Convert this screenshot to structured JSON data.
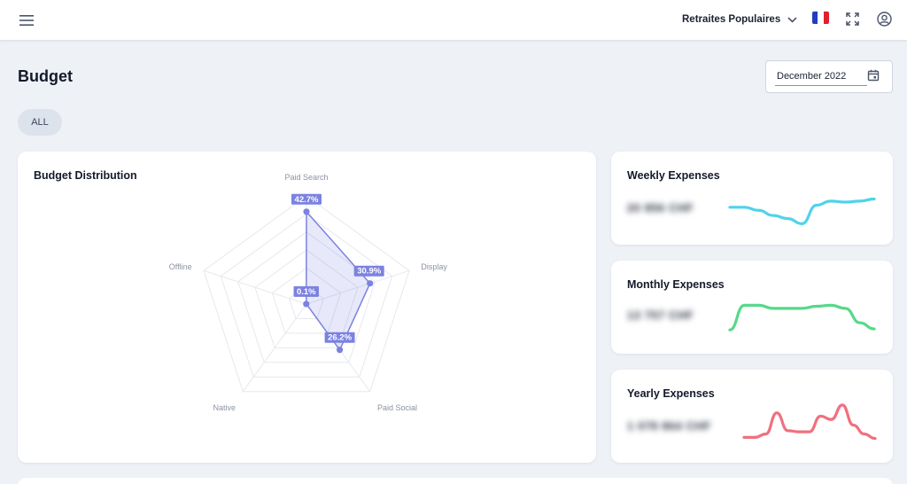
{
  "topbar": {
    "menu_icon": "hamburger-menu-icon",
    "organization": "Retraites Populaires",
    "language_flag": "france-flag-icon",
    "flag_colors": [
      "#1f3fbf",
      "#ffffff",
      "#e0202e"
    ],
    "fullscreen_icon": "fullscreen-icon",
    "account_icon": "user-account-icon"
  },
  "page": {
    "title": "Budget",
    "date_filter": "December 2022",
    "calendar_icon": "calendar-icon",
    "filter_chip": "ALL"
  },
  "radar_card": {
    "title": "Budget Distribution",
    "accent": "#7b82e0"
  },
  "chart_data": {
    "type": "radar",
    "categories": [
      "Paid Search",
      "Display",
      "Paid Social",
      "Native",
      "Offline"
    ],
    "values": [
      42.7,
      30.9,
      26.2,
      0.0,
      0.1
    ],
    "labels": [
      "42.7%",
      "30.9%",
      "26.2%",
      "",
      "0.1%"
    ],
    "rmax": 50,
    "grid_rings": 6
  },
  "stats": [
    {
      "title": "Weekly Expenses",
      "value": "20 856 CHF",
      "color": "#4fd3ea",
      "points": [
        40,
        40,
        34,
        24,
        18,
        8,
        44,
        52,
        50,
        52,
        56
      ]
    },
    {
      "title": "Monthly Expenses",
      "value": "13 757 CHF",
      "color": "#56d989",
      "points": [
        10,
        58,
        58,
        52,
        52,
        52,
        56,
        58,
        52,
        24,
        12
      ]
    },
    {
      "title": "Yearly Expenses",
      "value": "1 078 864 CHF",
      "color": "#f0707f",
      "points": [
        20,
        20,
        26,
        64,
        32,
        30,
        30,
        58,
        52,
        78,
        42,
        26,
        18
      ]
    }
  ]
}
